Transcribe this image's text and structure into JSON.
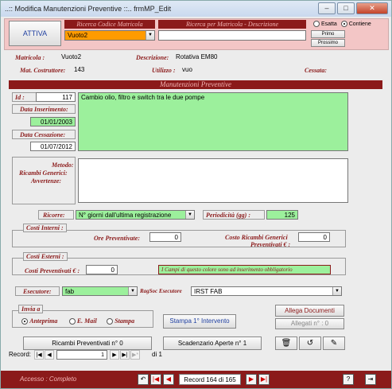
{
  "window": {
    "title": "..:: Modifica Manutenzioni Preventive ::..   frmMP_Edit",
    "min": "–",
    "max": "□",
    "close": "✕"
  },
  "header": {
    "attiva_label": "ATTIVA",
    "ricerca_codice_label": "Ricerca Codice Matricola",
    "ricerca_codice_value": "Vuoto2",
    "ricerca_matricola_label": "Ricerca per Matricola - Descrizione",
    "esatta_label": "Esatta",
    "contiene_label": "Contiene",
    "primo_label": "Primo",
    "prossimo_label": "Prossimo"
  },
  "info": {
    "matricola_label": "Matricola :",
    "matricola_value": "Vuoto2",
    "descrizione_label": "Descrizione:",
    "descrizione_value": "Rotativa EM80",
    "costruttore_label": "Mat. Costruttore:",
    "costruttore_value": "143",
    "utilizzo_label": "Utilizzo :",
    "utilizzo_value": "vuo",
    "cessata_label": "Cessata:"
  },
  "section_title": "Manutenzioni Preventive",
  "form": {
    "id_label": "Id :",
    "id_value": "117",
    "data_ins_label": "Data Inserimento:",
    "data_ins_value": "01/01/2003",
    "data_cess_label": "Data Cessazione:",
    "data_cess_value": "01/07/2012",
    "metodo_label": "Metodo:",
    "ricambi_label": "Ricambi Generici:",
    "avvertenze_label": "Avvertenze:",
    "descrizione_value": "Cambio olio, filtro e switch tra le due pompe",
    "ricorre_label": "Ricorre:",
    "ricorre_value": "N° giorni dall'ultima registrazione",
    "periodicita_label": "Periodicità (gg) :",
    "periodicita_value": "125",
    "costi_interni_label": "Costi Interni :",
    "ore_prev_label": "Ore Preventivate:",
    "ore_prev_value": "0",
    "costo_ricambi_label1": "Costo Ricambi Generici",
    "costo_ricambi_label2": "Preventivati € :",
    "costo_ricambi_value": "0",
    "costi_esterni_label": "Costi Esterni :",
    "costi_prev_label": "Costi Preventivati € :",
    "costi_prev_value": "0",
    "campi_note": "I Campi di questo colore sono ad inserimento obbligatorio",
    "esecutore_label": "Esecutore:",
    "esecutore_value": "fab",
    "ragsoc_label": "RagSoc Esecutore",
    "ragsoc_value": "IRST FAB",
    "invia_label": "Invia a",
    "anteprima_label": "Anteprima",
    "email_label": "E. Mail",
    "stampa_label": "Stampa",
    "stampa_intervento_label": "Stampa 1° Intervento",
    "allega_label": "Allega Documenti",
    "allegati_label": "Allegati n° :  0",
    "ricambi_prev_label": "Ricambi Preventivati n° 0",
    "scadenzario_label": "Scadenzario Aperte n° 1"
  },
  "record_nav": {
    "label": "Record:",
    "current": "1",
    "total_text": "di 1"
  },
  "footer": {
    "accesso": "Accesso : Completo",
    "record_text": "Record 164 di 165"
  }
}
